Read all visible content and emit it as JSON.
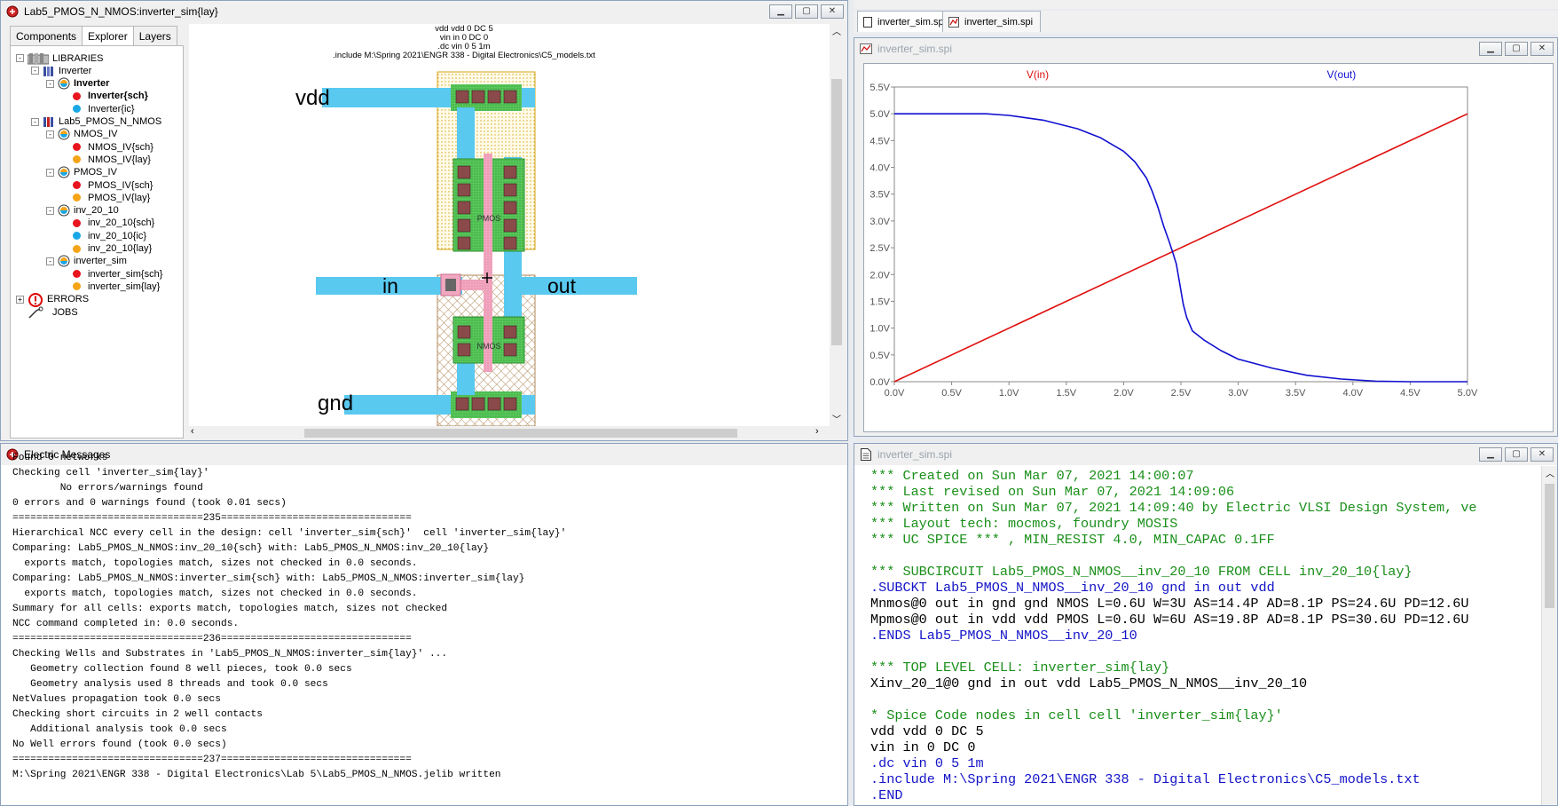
{
  "electric": {
    "title": "Lab5_PMOS_N_NMOS:inverter_sim{lay}",
    "tabs": [
      "Components",
      "Explorer",
      "Layers"
    ],
    "tree": [
      {
        "label": "LIBRARIES",
        "level": 0,
        "kind": "lib",
        "exp": "-"
      },
      {
        "label": "Inverter",
        "level": 1,
        "kind": "libx",
        "exp": "-"
      },
      {
        "label": "Inverter",
        "level": 2,
        "kind": "cell",
        "exp": "-",
        "bold": true
      },
      {
        "label": "Inverter{sch}",
        "level": 3,
        "kind": "red",
        "bold": true
      },
      {
        "label": "Inverter{ic}",
        "level": 3,
        "kind": "blue"
      },
      {
        "label": "Lab5_PMOS_N_NMOS",
        "level": 1,
        "kind": "libred",
        "exp": "-"
      },
      {
        "label": "NMOS_IV",
        "level": 2,
        "kind": "cell",
        "exp": "-"
      },
      {
        "label": "NMOS_IV{sch}",
        "level": 3,
        "kind": "red"
      },
      {
        "label": "NMOS_IV{lay}",
        "level": 3,
        "kind": "orange"
      },
      {
        "label": "PMOS_IV",
        "level": 2,
        "kind": "cell",
        "exp": "-"
      },
      {
        "label": "PMOS_IV{sch}",
        "level": 3,
        "kind": "red"
      },
      {
        "label": "PMOS_IV{lay}",
        "level": 3,
        "kind": "orange"
      },
      {
        "label": "inv_20_10",
        "level": 2,
        "kind": "cell",
        "exp": "-"
      },
      {
        "label": "inv_20_10{sch}",
        "level": 3,
        "kind": "red"
      },
      {
        "label": "inv_20_10{ic}",
        "level": 3,
        "kind": "blue"
      },
      {
        "label": "inv_20_10{lay}",
        "level": 3,
        "kind": "orange"
      },
      {
        "label": "inverter_sim",
        "level": 2,
        "kind": "cell",
        "exp": "-"
      },
      {
        "label": "inverter_sim{sch}",
        "level": 3,
        "kind": "red"
      },
      {
        "label": "inverter_sim{lay}",
        "level": 3,
        "kind": "orange"
      },
      {
        "label": "ERRORS",
        "level": 0,
        "kind": "err",
        "exp": "+"
      },
      {
        "label": "JOBS",
        "level": 0,
        "kind": "jobs"
      }
    ],
    "layout": {
      "spice_lines": [
        "vdd vdd 0 DC 5",
        "vin in 0 DC 0",
        ".dc vin 0 5 1m",
        ".include M:\\Spring 2021\\ENGR 338 - Digital Electronics\\C5_models.txt"
      ],
      "labels": {
        "vdd": "vdd",
        "in": "in",
        "out": "out",
        "gnd": "gnd",
        "pmos": "PMOS",
        "nmos": "NMOS"
      }
    }
  },
  "messages": {
    "title": "Electric Messages",
    "lines": [
      "Found 0 networks",
      "Checking cell 'inverter_sim{lay}'",
      "        No errors/warnings found",
      "0 errors and 0 warnings found (took 0.01 secs)",
      "================================235================================",
      "Hierarchical NCC every cell in the design: cell 'inverter_sim{sch}'  cell 'inverter_sim{lay}'",
      "Comparing: Lab5_PMOS_N_NMOS:inv_20_10{sch} with: Lab5_PMOS_N_NMOS:inv_20_10{lay}",
      "  exports match, topologies match, sizes not checked in 0.0 seconds.",
      "Comparing: Lab5_PMOS_N_NMOS:inverter_sim{sch} with: Lab5_PMOS_N_NMOS:inverter_sim{lay}",
      "  exports match, topologies match, sizes not checked in 0.0 seconds.",
      "Summary for all cells: exports match, topologies match, sizes not checked",
      "NCC command completed in: 0.0 seconds.",
      "================================236================================",
      "Checking Wells and Substrates in 'Lab5_PMOS_N_NMOS:inverter_sim{lay}' ...",
      "   Geometry collection found 8 well pieces, took 0.0 secs",
      "   Geometry analysis used 8 threads and took 0.0 secs",
      "NetValues propagation took 0.0 secs",
      "Checking short circuits in 2 well contacts",
      "   Additional analysis took 0.0 secs",
      "No Well errors found (took 0.0 secs)",
      "================================237================================",
      "M:\\Spring 2021\\ENGR 338 - Digital Electronics\\Lab 5\\Lab5_PMOS_N_NMOS.jelib written"
    ]
  },
  "spice_tabs": [
    "inverter_sim.spi",
    "inverter_sim.spi"
  ],
  "plot_window": {
    "title": "inverter_sim.spi"
  },
  "chart_data": {
    "type": "line",
    "title": "",
    "series": [
      {
        "name": "V(in)",
        "color": "#e01010",
        "x": [
          0.0,
          5.0
        ],
        "y": [
          0.0,
          5.0
        ]
      },
      {
        "name": "V(out)",
        "color": "#1010d0",
        "x": [
          0.0,
          0.8,
          1.0,
          1.3,
          1.6,
          1.8,
          2.0,
          2.1,
          2.2,
          2.25,
          2.3,
          2.35,
          2.4,
          2.43,
          2.46,
          2.48,
          2.5,
          2.52,
          2.55,
          2.6,
          2.7,
          2.85,
          3.0,
          3.3,
          3.6,
          3.9,
          4.2,
          4.5,
          5.0
        ],
        "y": [
          5.0,
          5.0,
          4.97,
          4.88,
          4.72,
          4.55,
          4.3,
          4.1,
          3.8,
          3.55,
          3.25,
          2.9,
          2.6,
          2.4,
          2.2,
          1.95,
          1.7,
          1.45,
          1.2,
          0.95,
          0.78,
          0.58,
          0.42,
          0.25,
          0.12,
          0.05,
          0.01,
          0.0,
          0.0
        ]
      }
    ],
    "xlim": [
      0,
      5
    ],
    "ylim": [
      0,
      5.5
    ],
    "xticks": [
      "0.0V",
      "0.5V",
      "1.0V",
      "1.5V",
      "2.0V",
      "2.5V",
      "3.0V",
      "3.5V",
      "4.0V",
      "4.5V",
      "5.0V"
    ],
    "yticks": [
      "0.0V",
      "0.5V",
      "1.0V",
      "1.5V",
      "2.0V",
      "2.5V",
      "3.0V",
      "3.5V",
      "4.0V",
      "4.5V",
      "5.0V",
      "5.5V"
    ],
    "grid": false
  },
  "netlist": {
    "title": "inverter_sim.spi",
    "lines": [
      {
        "t": "*** Created on Sun Mar 07, 2021 14:00:07",
        "c": "cm"
      },
      {
        "t": "*** Last revised on Sun Mar 07, 2021 14:09:06",
        "c": "cm"
      },
      {
        "t": "*** Written on Sun Mar 07, 2021 14:09:40 by Electric VLSI Design System, ve",
        "c": "cm"
      },
      {
        "t": "*** Layout tech: mocmos, foundry MOSIS",
        "c": "cm"
      },
      {
        "t": "*** UC SPICE *** , MIN_RESIST 4.0, MIN_CAPAC 0.1FF",
        "c": "cm"
      },
      {
        "t": "",
        "c": "bk"
      },
      {
        "t": "*** SUBCIRCUIT Lab5_PMOS_N_NMOS__inv_20_10 FROM CELL inv_20_10{lay}",
        "c": "cm"
      },
      {
        "t": ".SUBCKT Lab5_PMOS_N_NMOS__inv_20_10 gnd in out vdd",
        "c": "dr"
      },
      {
        "t": "Mnmos@0 out in gnd gnd NMOS L=0.6U W=3U AS=14.4P AD=8.1P PS=24.6U PD=12.6U",
        "c": "bk"
      },
      {
        "t": "Mpmos@0 out in vdd vdd PMOS L=0.6U W=6U AS=19.8P AD=8.1P PS=30.6U PD=12.6U",
        "c": "bk"
      },
      {
        "t": ".ENDS Lab5_PMOS_N_NMOS__inv_20_10",
        "c": "dr"
      },
      {
        "t": "",
        "c": "bk"
      },
      {
        "t": "*** TOP LEVEL CELL: inverter_sim{lay}",
        "c": "cm"
      },
      {
        "t": "Xinv_20_1@0 gnd in out vdd Lab5_PMOS_N_NMOS__inv_20_10",
        "c": "bk"
      },
      {
        "t": "",
        "c": "bk"
      },
      {
        "t": "* Spice Code nodes in cell cell 'inverter_sim{lay}'",
        "c": "cm"
      },
      {
        "t": "vdd vdd 0 DC 5",
        "c": "bk"
      },
      {
        "t": "vin in 0 DC 0",
        "c": "bk"
      },
      {
        "t": ".dc vin 0 5 1m",
        "c": "dr"
      },
      {
        "t": ".include M:\\Spring 2021\\ENGR 338 - Digital Electronics\\C5_models.txt",
        "c": "dr"
      },
      {
        "t": ".END",
        "c": "dr"
      }
    ]
  }
}
